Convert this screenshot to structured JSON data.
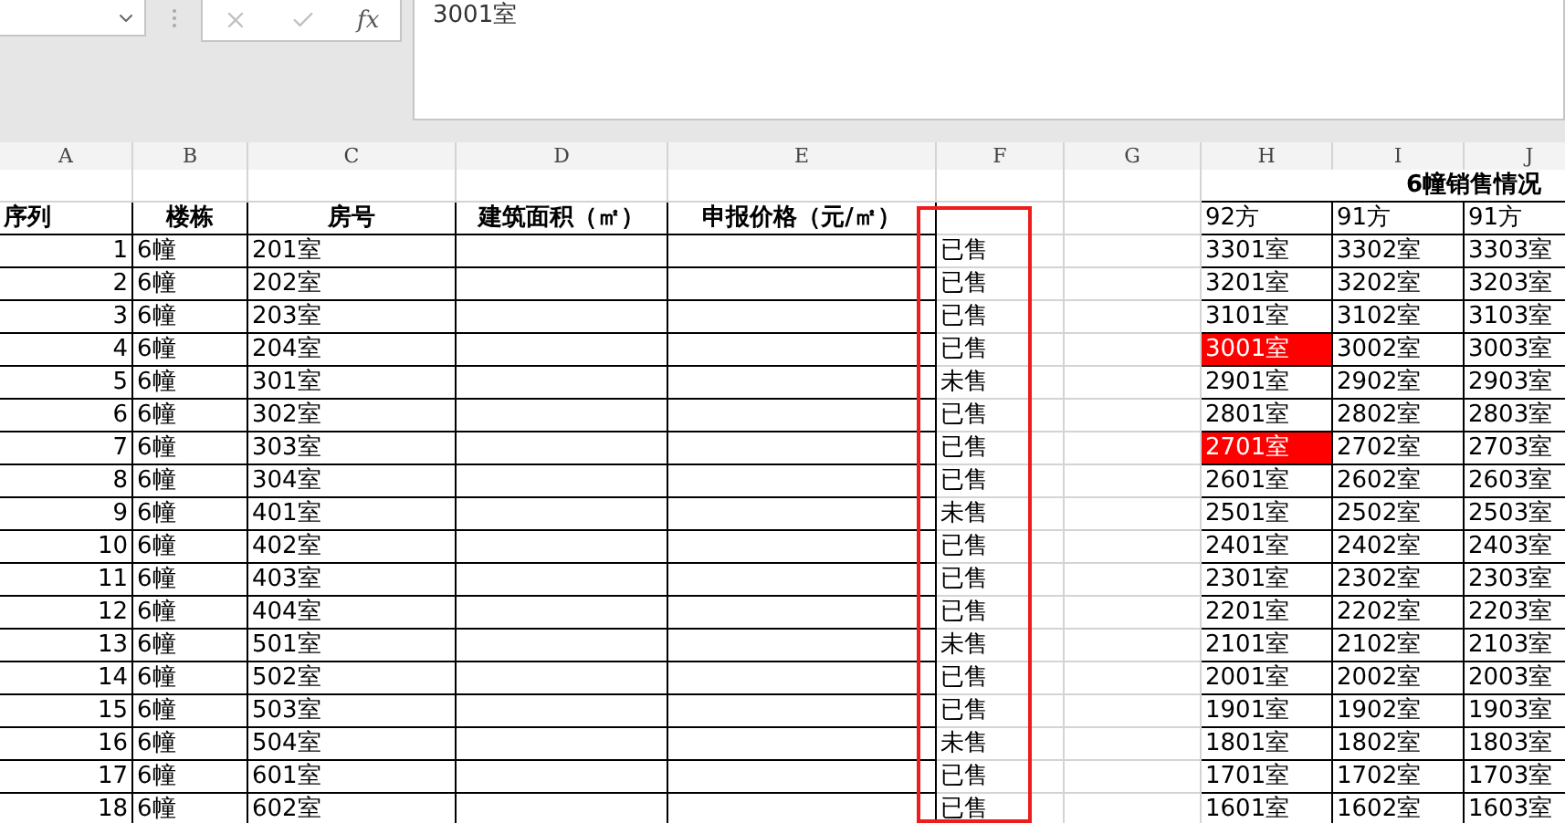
{
  "formula_bar": {
    "cancel_enabled": false,
    "function_label": "fx",
    "value": "3001室"
  },
  "column_headers": [
    "A",
    "B",
    "C",
    "D",
    "E",
    "F",
    "G",
    "H",
    "I",
    "J"
  ],
  "sales_title": "6幢销售情况",
  "table_headers": [
    "序列",
    "楼栋",
    "房号",
    "建筑面积（㎡）",
    "申报价格（元/㎡）"
  ],
  "unit_areas": [
    "92方",
    "91方",
    "91方"
  ],
  "rows": [
    {
      "index": "1",
      "building": "6幢",
      "room": "201室",
      "status": "已售",
      "units": [
        {
          "text": "3301室",
          "highlighted": false
        },
        {
          "text": "3302室",
          "highlighted": false
        },
        {
          "text": "3303室",
          "highlighted": false
        }
      ]
    },
    {
      "index": "2",
      "building": "6幢",
      "room": "202室",
      "status": "已售",
      "units": [
        {
          "text": "3201室",
          "highlighted": false
        },
        {
          "text": "3202室",
          "highlighted": false
        },
        {
          "text": "3203室",
          "highlighted": false
        }
      ]
    },
    {
      "index": "3",
      "building": "6幢",
      "room": "203室",
      "status": "已售",
      "units": [
        {
          "text": "3101室",
          "highlighted": false
        },
        {
          "text": "3102室",
          "highlighted": false
        },
        {
          "text": "3103室",
          "highlighted": false
        }
      ]
    },
    {
      "index": "4",
      "building": "6幢",
      "room": "204室",
      "status": "已售",
      "units": [
        {
          "text": "3001室",
          "highlighted": true
        },
        {
          "text": "3002室",
          "highlighted": false
        },
        {
          "text": "3003室",
          "highlighted": false
        }
      ]
    },
    {
      "index": "5",
      "building": "6幢",
      "room": "301室",
      "status": "未售",
      "units": [
        {
          "text": "2901室",
          "highlighted": false
        },
        {
          "text": "2902室",
          "highlighted": false
        },
        {
          "text": "2903室",
          "highlighted": false
        }
      ]
    },
    {
      "index": "6",
      "building": "6幢",
      "room": "302室",
      "status": "已售",
      "units": [
        {
          "text": "2801室",
          "highlighted": false
        },
        {
          "text": "2802室",
          "highlighted": false
        },
        {
          "text": "2803室",
          "highlighted": false
        }
      ]
    },
    {
      "index": "7",
      "building": "6幢",
      "room": "303室",
      "status": "已售",
      "units": [
        {
          "text": "2701室",
          "highlighted": true
        },
        {
          "text": "2702室",
          "highlighted": false
        },
        {
          "text": "2703室",
          "highlighted": false
        }
      ]
    },
    {
      "index": "8",
      "building": "6幢",
      "room": "304室",
      "status": "已售",
      "units": [
        {
          "text": "2601室",
          "highlighted": false
        },
        {
          "text": "2602室",
          "highlighted": false
        },
        {
          "text": "2603室",
          "highlighted": false
        }
      ]
    },
    {
      "index": "9",
      "building": "6幢",
      "room": "401室",
      "status": "未售",
      "units": [
        {
          "text": "2501室",
          "highlighted": false
        },
        {
          "text": "2502室",
          "highlighted": false
        },
        {
          "text": "2503室",
          "highlighted": false
        }
      ]
    },
    {
      "index": "10",
      "building": "6幢",
      "room": "402室",
      "status": "已售",
      "units": [
        {
          "text": "2401室",
          "highlighted": false
        },
        {
          "text": "2402室",
          "highlighted": false
        },
        {
          "text": "2403室",
          "highlighted": false
        }
      ]
    },
    {
      "index": "11",
      "building": "6幢",
      "room": "403室",
      "status": "已售",
      "units": [
        {
          "text": "2301室",
          "highlighted": false
        },
        {
          "text": "2302室",
          "highlighted": false
        },
        {
          "text": "2303室",
          "highlighted": false
        }
      ]
    },
    {
      "index": "12",
      "building": "6幢",
      "room": "404室",
      "status": "已售",
      "units": [
        {
          "text": "2201室",
          "highlighted": false
        },
        {
          "text": "2202室",
          "highlighted": false
        },
        {
          "text": "2203室",
          "highlighted": false
        }
      ]
    },
    {
      "index": "13",
      "building": "6幢",
      "room": "501室",
      "status": "未售",
      "units": [
        {
          "text": "2101室",
          "highlighted": false
        },
        {
          "text": "2102室",
          "highlighted": false
        },
        {
          "text": "2103室",
          "highlighted": false
        }
      ]
    },
    {
      "index": "14",
      "building": "6幢",
      "room": "502室",
      "status": "已售",
      "units": [
        {
          "text": "2001室",
          "highlighted": false
        },
        {
          "text": "2002室",
          "highlighted": false
        },
        {
          "text": "2003室",
          "highlighted": false
        }
      ]
    },
    {
      "index": "15",
      "building": "6幢",
      "room": "503室",
      "status": "已售",
      "units": [
        {
          "text": "1901室",
          "highlighted": false
        },
        {
          "text": "1902室",
          "highlighted": false
        },
        {
          "text": "1903室",
          "highlighted": false
        }
      ]
    },
    {
      "index": "16",
      "building": "6幢",
      "room": "504室",
      "status": "未售",
      "units": [
        {
          "text": "1801室",
          "highlighted": false
        },
        {
          "text": "1802室",
          "highlighted": false
        },
        {
          "text": "1803室",
          "highlighted": false
        }
      ]
    },
    {
      "index": "17",
      "building": "6幢",
      "room": "601室",
      "status": "已售",
      "units": [
        {
          "text": "1701室",
          "highlighted": false
        },
        {
          "text": "1702室",
          "highlighted": false
        },
        {
          "text": "1703室",
          "highlighted": false
        }
      ]
    },
    {
      "index": "18",
      "building": "6幢",
      "room": "602室",
      "status": "已售",
      "units": [
        {
          "text": "1601室",
          "highlighted": false
        },
        {
          "text": "1602室",
          "highlighted": false
        },
        {
          "text": "1603室",
          "highlighted": false
        }
      ]
    }
  ]
}
